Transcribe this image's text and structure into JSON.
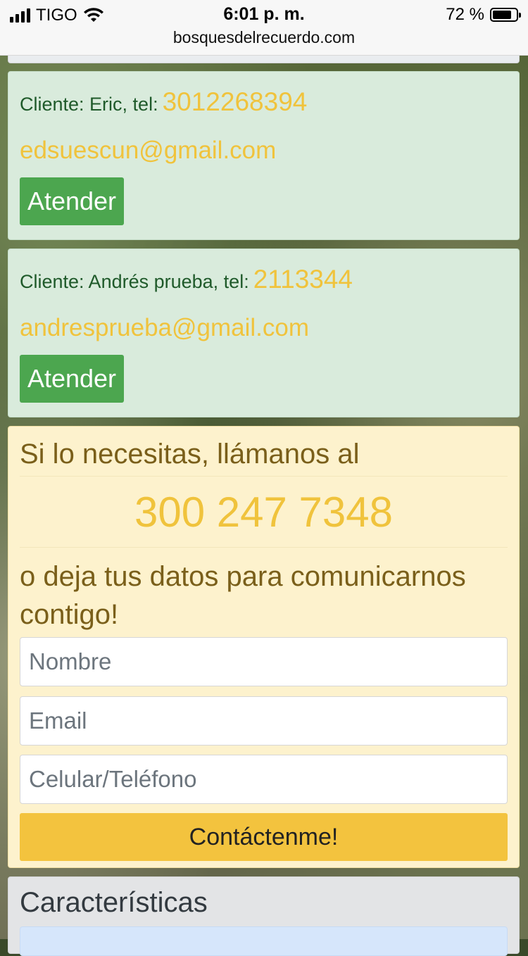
{
  "status_bar": {
    "carrier": "TIGO",
    "time": "6:01 p. m.",
    "battery": "72 %",
    "battery_level": 0.72,
    "url": "bosquesdelrecuerdo.com"
  },
  "clients": [
    {
      "label": "Cliente: Eric, tel:",
      "phone": "3012268394",
      "email": "edsuescun@gmail.com",
      "button": "Atender"
    },
    {
      "label": "Cliente: Andrés prueba, tel:",
      "phone": "2113344",
      "email": "andresprueba@gmail.com",
      "button": "Atender"
    }
  ],
  "contact": {
    "heading": "Si lo necesitas, llámanos al",
    "phone": "300 247 7348",
    "subheading": "o deja tus datos para comunicarnos contigo!",
    "fields": {
      "name_placeholder": "Nombre",
      "email_placeholder": "Email",
      "phone_placeholder": "Celular/Teléfono"
    },
    "submit_label": "Contáctenme!"
  },
  "features": {
    "title": "Características"
  },
  "colors": {
    "client_bg": "#d9ebdc",
    "accent_yellow": "#f0c33c",
    "button_green": "#4ca64f",
    "contact_bg": "#fdf2cd",
    "submit_bg": "#f3c33e"
  }
}
